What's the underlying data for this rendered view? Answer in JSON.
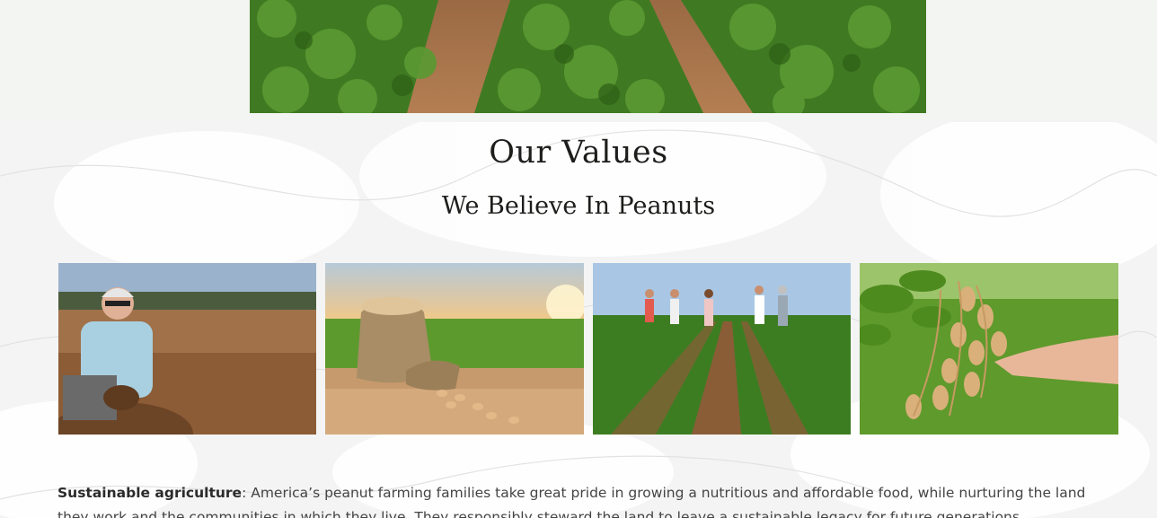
{
  "hero": {
    "image": "peanut-field-rows-photo"
  },
  "section": {
    "heading": "Our Values",
    "subheading": "We Believe In Peanuts"
  },
  "photos": [
    {
      "name": "farmer-inspecting-peanuts-photo"
    },
    {
      "name": "burlap-sack-peanuts-photo"
    },
    {
      "name": "family-walking-peanut-field-photo"
    },
    {
      "name": "hand-holding-peanut-plant-photo"
    }
  ],
  "values": [
    {
      "title": "Sustainable agriculture",
      "text": ": America’s peanut farming families take great pride in growing a nutritious and affordable food, while nurturing the land they work and the communities in which they live. They responsibly steward the land to leave a sustainable legacy for future generations."
    }
  ],
  "colors": {
    "heading": "#1d1d1b",
    "body_text": "#444444",
    "background": "#f4f4f4"
  }
}
